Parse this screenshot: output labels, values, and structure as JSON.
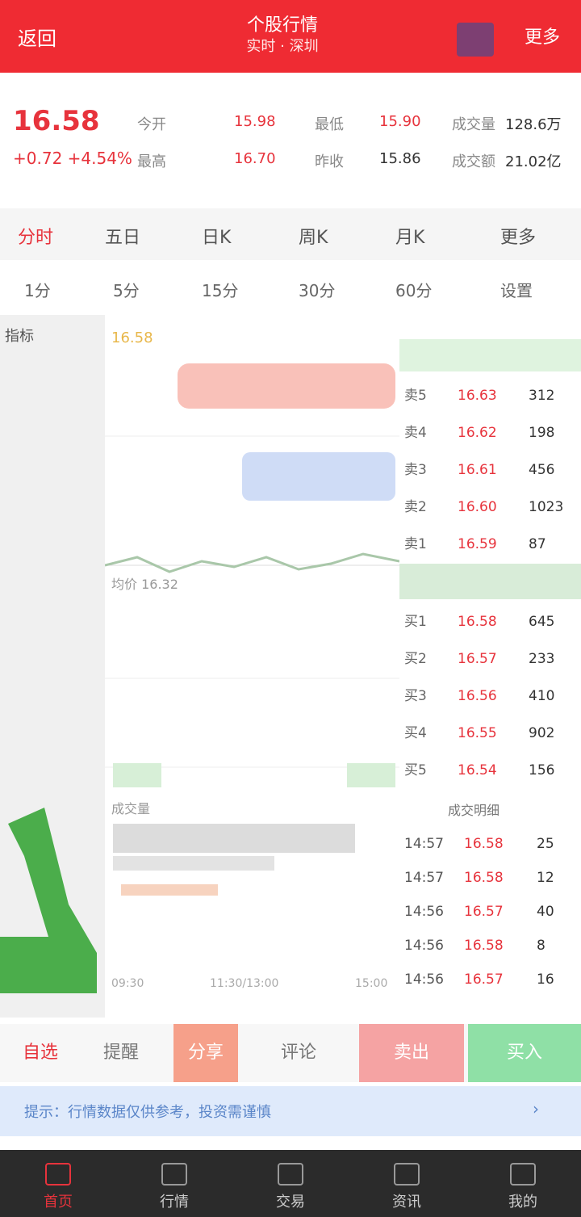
{
  "header": {
    "back_label": "返回",
    "title": "个股行情",
    "subtitle": "实时 · 深圳",
    "menu_label": "更多"
  },
  "quote": {
    "price": "16.58",
    "change": "+0.72  +4.54%",
    "fields": [
      {
        "label": "今开",
        "value": "15.98"
      },
      {
        "label": "最高",
        "value": "16.70"
      },
      {
        "label": "最低",
        "value": "15.90"
      },
      {
        "label": "昨收",
        "value": "15.86"
      },
      {
        "label": "成交量",
        "value": "128.6万"
      },
      {
        "label": "成交额",
        "value": "21.02亿"
      }
    ]
  },
  "tabs": [
    "分时",
    "五日",
    "日K",
    "周K",
    "月K",
    "更多"
  ],
  "period_tabs": [
    "1分",
    "5分",
    "15分",
    "30分",
    "60分",
    "设置"
  ],
  "rail": {
    "label": "指标"
  },
  "chart": {
    "open_label": "16.58",
    "avg_label": "均价 16.32",
    "vol_label": "成交量",
    "time_start": "09:30",
    "time_mid": "11:30/13:00",
    "time_end": "15:00"
  },
  "order_book": {
    "sell": [
      {
        "name": "卖5",
        "price": "16.63",
        "vol": "312"
      },
      {
        "name": "卖4",
        "price": "16.62",
        "vol": "198"
      },
      {
        "name": "卖3",
        "price": "16.61",
        "vol": "456"
      },
      {
        "name": "卖2",
        "price": "16.60",
        "vol": "1023"
      },
      {
        "name": "卖1",
        "price": "16.59",
        "vol": "87"
      }
    ],
    "buy": [
      {
        "name": "买1",
        "price": "16.58",
        "vol": "645"
      },
      {
        "name": "买2",
        "price": "16.57",
        "vol": "233"
      },
      {
        "name": "买3",
        "price": "16.56",
        "vol": "410"
      },
      {
        "name": "买4",
        "price": "16.55",
        "vol": "902"
      },
      {
        "name": "买5",
        "price": "16.54",
        "vol": "156"
      }
    ],
    "ticks_header": "成交明细",
    "ticks": [
      {
        "time": "14:57",
        "price": "16.58",
        "vol": "25"
      },
      {
        "time": "14:57",
        "price": "16.58",
        "vol": "12"
      },
      {
        "time": "14:56",
        "price": "16.57",
        "vol": "40"
      },
      {
        "time": "14:56",
        "price": "16.58",
        "vol": "8"
      },
      {
        "time": "14:56",
        "price": "16.57",
        "vol": "16"
      }
    ]
  },
  "actions": [
    "自选",
    "提醒",
    "分享",
    "评论",
    "卖出",
    "买入"
  ],
  "notice": {
    "text": "提示：行情数据仅供参考，投资需谨慎"
  },
  "nav": [
    "首页",
    "行情",
    "交易",
    "资讯",
    "我的"
  ],
  "colors": {
    "header": "#ef2b33",
    "up": "#e7333c",
    "down": "#1fa01f"
  }
}
